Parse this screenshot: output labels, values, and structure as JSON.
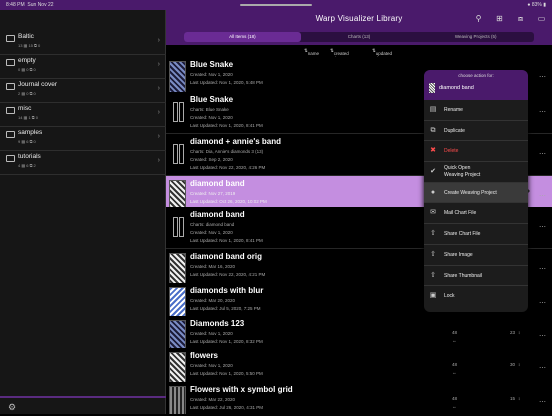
{
  "status": {
    "time": "8:48 PM",
    "date": "Sun Nov 22",
    "battery": "83%"
  },
  "header": {
    "title": "Warp Visualizer Library",
    "tabs": [
      "All Items (18)",
      "Charts (13)",
      "Weaving Projects (5)"
    ],
    "sort": [
      "name",
      "created date",
      "updated date"
    ]
  },
  "sidebar": {
    "items": [
      {
        "name": "Baltic",
        "meta": "13 ▦ 15 ⧉ 0"
      },
      {
        "name": "empty",
        "meta": "0 ▦ 0 ⧉ 0"
      },
      {
        "name": "Journal cover",
        "meta": "2 ▦ 0 ⧉ 0"
      },
      {
        "name": "misc",
        "meta": "14 ▦ 1 ⧉ 0"
      },
      {
        "name": "samples",
        "meta": "9 ▦ 6 ⧉ 0"
      },
      {
        "name": "tutorials",
        "meta": "4 ▦ 6 ⧉ 2"
      }
    ]
  },
  "rows": [
    {
      "name": "Blue Snake",
      "l1": "Created: Nov 1, 2020",
      "l2": "Last Updated: Nov 1, 2020, 5:48 PM",
      "l3": ""
    },
    {
      "name": "Blue Snake",
      "l1": "Charts: Blue Snake",
      "l2": "Created: Nov 1, 2020",
      "l3": "Last Updated: Nov 1, 2020, 8:41 PM"
    },
    {
      "name": "diamond + annie's band",
      "l1": "Charts: Dia, Annie's diamonds 3 (13)",
      "l2": "Created: Sep 2, 2020",
      "l3": "Last Updated: Nov 22, 2020, 4:26 PM"
    },
    {
      "name": "diamond band",
      "l1": "Created: Nov 27, 2019",
      "l2": "Last Updated: Oct 26, 2020, 10:02 PM",
      "l3": ""
    },
    {
      "name": "diamond band",
      "l1": "Charts: diamond band",
      "l2": "Created: Nov 1, 2020",
      "l3": "Last Updated: Nov 1, 2020, 8:41 PM"
    },
    {
      "name": "diamond band orig",
      "l1": "Created: Mar 16, 2020",
      "l2": "Last Updated: Nov 22, 2020, 4:21 PM",
      "l3": ""
    },
    {
      "name": "diamonds with blur",
      "l1": "Created: Mar 20, 2020",
      "l2": "Last Updated: Jul 5, 2020, 7:25 PM",
      "l3": ""
    },
    {
      "name": "Diamonds 123",
      "l1": "Created: Nov 1, 2020",
      "l2": "Last Updated: Nov 1, 2020, 8:32 PM",
      "l3": ""
    },
    {
      "name": "flowers",
      "l1": "Created: Nov 1, 2020",
      "l2": "Last Updated: Nov 1, 2020, 5:50 PM",
      "l3": ""
    },
    {
      "name": "Flowers with x symbol grid",
      "l1": "Created: Mar 22, 2020",
      "l2": "Last Updated: Jul 26, 2020, 4:31 PM",
      "l3": ""
    }
  ],
  "dims": [
    {
      "a": "48",
      "b": "23"
    },
    {
      "a": "48",
      "b": "30"
    },
    {
      "a": "48",
      "b": "15"
    }
  ],
  "menu": {
    "caption": "choose action for:",
    "target": "diamond band",
    "items": [
      "Rename",
      "Duplicate",
      "Delete",
      "Quick Open\nWeaving Project",
      "Create Weaving Project",
      "Mail Chart File",
      "Share Chart File",
      "Share Image",
      "Share Thumbnail",
      "Lock"
    ]
  }
}
